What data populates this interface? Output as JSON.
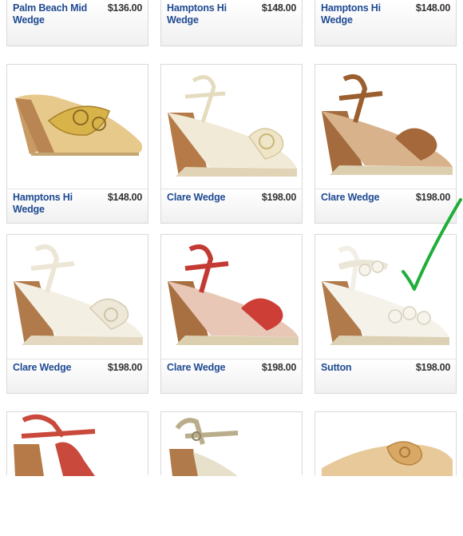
{
  "products_top_row": [
    {
      "name": "Palm Beach Mid Wedge",
      "price": "$136.00"
    },
    {
      "name": "Hamptons Hi Wedge",
      "price": "$148.00"
    },
    {
      "name": "Hamptons Hi Wedge",
      "price": "$148.00"
    }
  ],
  "products_row2": [
    {
      "name": "Hamptons Hi Wedge",
      "price": "$148.00",
      "color": "gold-metallic"
    },
    {
      "name": "Clare Wedge",
      "price": "$198.00",
      "color": "platinum"
    },
    {
      "name": "Clare Wedge",
      "price": "$198.00",
      "color": "cognac"
    }
  ],
  "products_row3": [
    {
      "name": "Clare Wedge",
      "price": "$198.00",
      "color": "white"
    },
    {
      "name": "Clare Wedge",
      "price": "$198.00",
      "color": "red"
    },
    {
      "name": "Sutton",
      "price": "$198.00",
      "color": "white"
    }
  ],
  "products_bottom_row": [
    {
      "color": "red"
    },
    {
      "color": "platinum"
    },
    {
      "color": "natural"
    }
  ],
  "colors": {
    "link_blue": "#1f4a92",
    "checkmark_green": "#1fae3a",
    "wedge_wood": "#b07a4a"
  }
}
